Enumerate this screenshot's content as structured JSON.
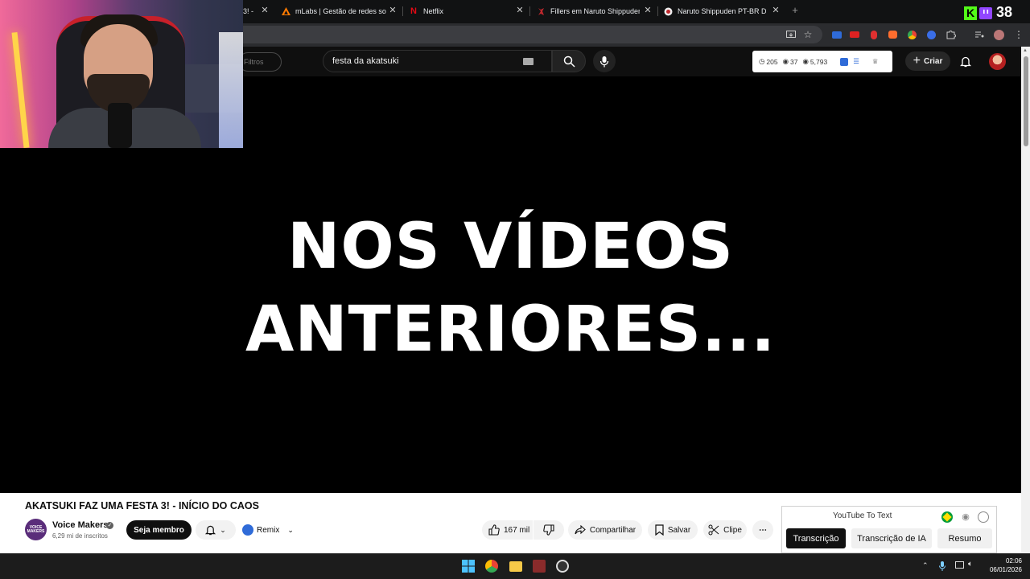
{
  "browser": {
    "tabs": [
      {
        "title": "3! -",
        "icon": "youtube-icon"
      },
      {
        "title": "mLabs | Gestão de redes sociais",
        "icon": "mlabs-icon"
      },
      {
        "title": "Netflix",
        "icon": "netflix-icon"
      },
      {
        "title": "Fillers em Naruto Shippuden: sa",
        "icon": "naruto-icon"
      },
      {
        "title": "Naruto Shippuden PT-BR Dubla",
        "icon": "naruto-icon"
      }
    ],
    "new_tab": "+",
    "stream_overlay": {
      "viewer_count": "38",
      "icons": [
        "kick-icon",
        "twitch-icon"
      ]
    }
  },
  "youtube": {
    "filters_label": "Filtros",
    "search_value": "festa da akatsuki",
    "stats": {
      "watch_time": "205",
      "views_small": "37",
      "views": "5,793"
    },
    "create_label": "Criar"
  },
  "video": {
    "line1": "NOS VÍDEOS",
    "line2": "ANTERIORES..."
  },
  "details": {
    "title": "AKATSUKI FAZ UMA FESTA 3! - INÍCIO DO CAOS",
    "channel": "Voice Makers",
    "channel_avatar_text": "VOICE MAKERS",
    "subscribers": "6,29 mi de inscritos",
    "join_label": "Seja membro",
    "remix_label": "Remix",
    "likes": "167 mil",
    "share_label": "Compartilhar",
    "save_label": "Salvar",
    "clip_label": "Clipe"
  },
  "youtube_to_text": {
    "title": "YouTube To Text",
    "tabs": [
      "Transcrição",
      "Transcrição de IA",
      "Resumo"
    ],
    "active_tab": "Transcrição"
  },
  "taskbar": {
    "time": "02:06",
    "date": "06/01/2026",
    "apps": [
      "windows-start-icon",
      "chrome-icon",
      "file-explorer-icon",
      "voice-makers-app-icon",
      "obs-icon"
    ]
  },
  "colors": {
    "accent_red": "#ff0000",
    "twitch_purple": "#9146ff",
    "kick_green": "#53fc18"
  }
}
